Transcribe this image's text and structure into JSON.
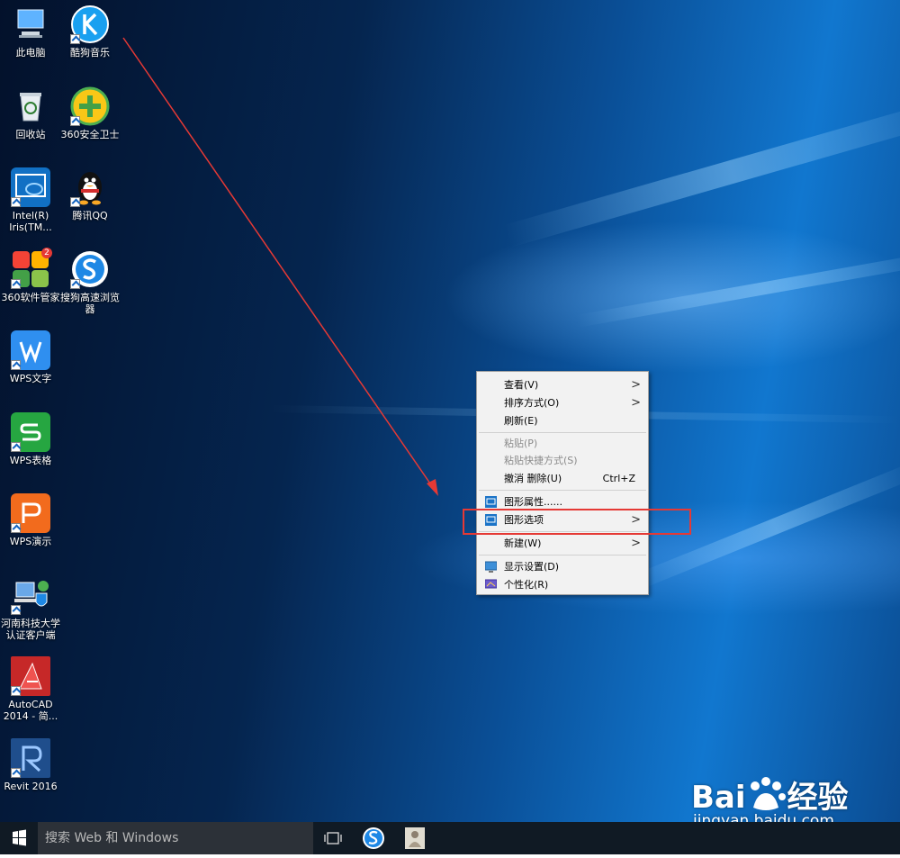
{
  "desktop_icons": [
    {
      "label": "此电脑"
    },
    {
      "label": "酷狗音乐"
    },
    {
      "label": "回收站"
    },
    {
      "label": "360安全卫士"
    },
    {
      "label": "Intel(R) Iris(TM..."
    },
    {
      "label": "腾讯QQ"
    },
    {
      "label": "360软件管家",
      "badge": "2"
    },
    {
      "label": "搜狗高速浏览器"
    },
    {
      "label": "WPS文字"
    },
    {
      "label": "WPS表格"
    },
    {
      "label": "WPS演示"
    },
    {
      "label": "河南科技大学认证客户端"
    },
    {
      "label": "AutoCAD 2014 - 简..."
    },
    {
      "label": "Revit 2016"
    }
  ],
  "context_menu": {
    "view": "查看(V)",
    "sort": "排序方式(O)",
    "refresh": "刷新(E)",
    "paste": "粘贴(P)",
    "paste_shortcut": "粘贴快捷方式(S)",
    "undo_delete": "撤消 删除(U)",
    "undo_shortcut": "Ctrl+Z",
    "graphics_properties": "图形属性......",
    "graphics_options": "图形选项",
    "new": "新建(W)",
    "display_settings": "显示设置(D)",
    "personalize": "个性化(R)",
    "submenu_arrow": ">"
  },
  "taskbar": {
    "search_placeholder": "搜索 Web 和 Windows"
  },
  "watermark": {
    "brand": "Bai",
    "brand_suffix": "经验",
    "url": "jingyan.baidu.com"
  },
  "colors": {
    "annotation_red": "#e53935",
    "menu_bg": "#f2f2f2",
    "taskbar_bg": "#101a24"
  }
}
